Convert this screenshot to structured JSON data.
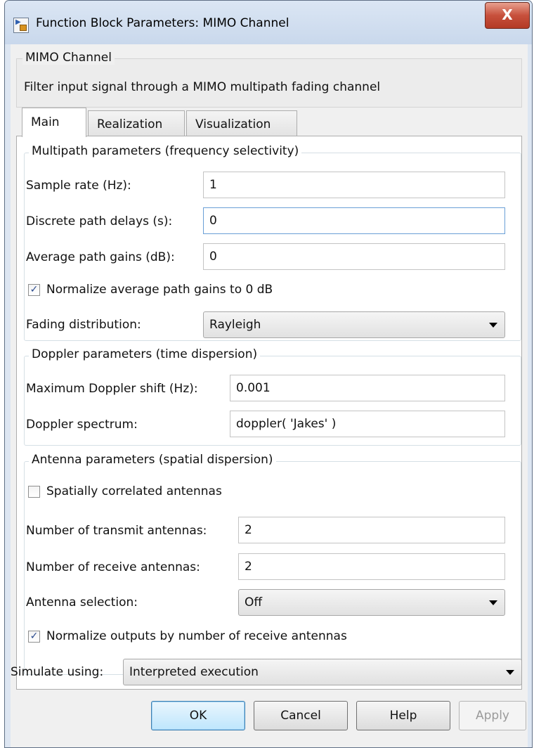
{
  "window": {
    "title": "Function Block Parameters: MIMO Channel",
    "close_glyph": "X"
  },
  "description": {
    "block_name": "MIMO Channel",
    "text": "Filter input signal through a MIMO multipath fading channel"
  },
  "tabs": [
    {
      "label": "Main",
      "active": true
    },
    {
      "label": "Realization",
      "active": false
    },
    {
      "label": "Visualization",
      "active": false
    }
  ],
  "multipath": {
    "legend": "Multipath parameters (frequency selectivity)",
    "sample_rate_label": "Sample rate (Hz):",
    "sample_rate_value": "1",
    "path_delays_label": "Discrete path delays (s):",
    "path_delays_value": "0",
    "path_gains_label": "Average path gains (dB):",
    "path_gains_value": "0",
    "normalize_label": "Normalize average path gains to 0 dB",
    "normalize_checked": true,
    "fading_label": "Fading distribution:",
    "fading_value": "Rayleigh"
  },
  "doppler": {
    "legend": "Doppler parameters (time dispersion)",
    "max_shift_label": "Maximum Doppler shift (Hz):",
    "max_shift_value": "0.001",
    "spectrum_label": "Doppler spectrum:",
    "spectrum_value": "doppler( 'Jakes' )"
  },
  "antenna": {
    "legend": "Antenna parameters (spatial dispersion)",
    "spatial_label": "Spatially correlated antennas",
    "spatial_checked": false,
    "tx_label": "Number of transmit antennas:",
    "tx_value": "2",
    "rx_label": "Number of receive antennas:",
    "rx_value": "2",
    "selection_label": "Antenna selection:",
    "selection_value": "Off",
    "normalize_outputs_label": "Normalize outputs by number of receive antennas",
    "normalize_outputs_checked": true
  },
  "simulate": {
    "label": "Simulate using:",
    "value": "Interpreted execution"
  },
  "buttons": {
    "ok": "OK",
    "cancel": "Cancel",
    "help": "Help",
    "apply": "Apply"
  },
  "check_glyph": "✓",
  "colors": {
    "title_bar": "#c9d8ec",
    "close_button": "#c7503c",
    "check_mark": "#2a4a8e",
    "focus_border": "#6a9fd6"
  }
}
